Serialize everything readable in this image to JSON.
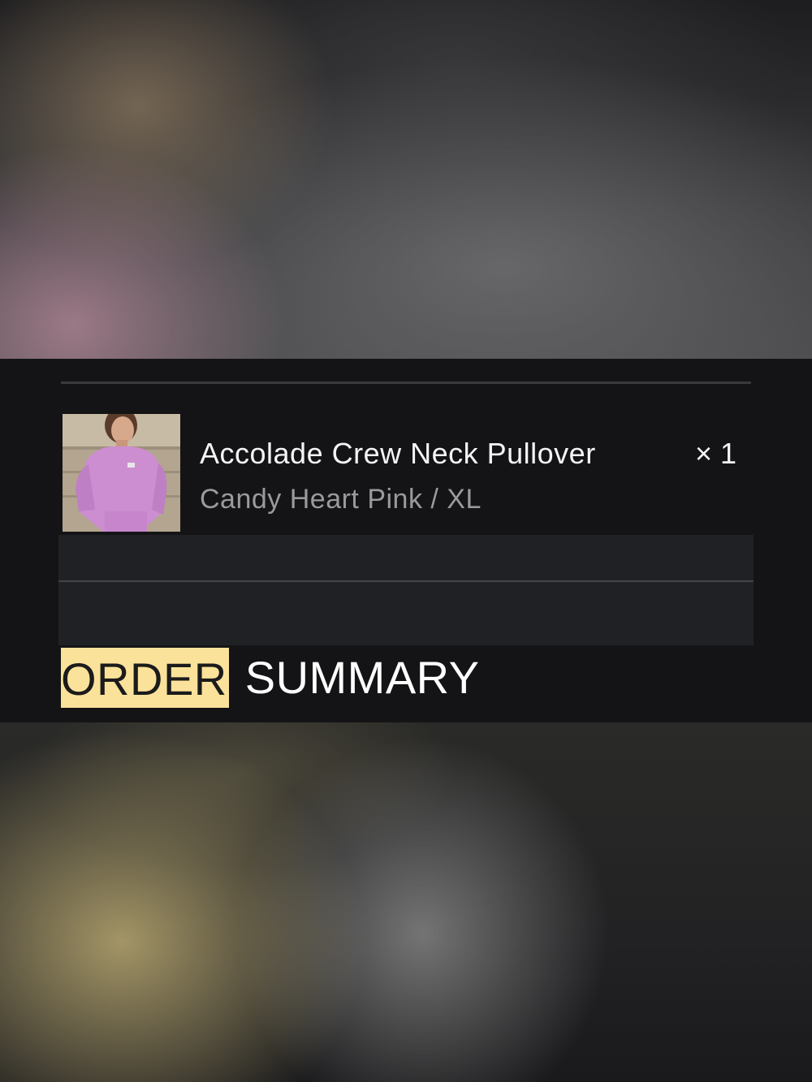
{
  "cart": {
    "line_items": [
      {
        "name": "Accolade Crew Neck Pullover",
        "quantity": "× 1",
        "variant": "Candy Heart Pink / XL",
        "image_icon": "product-thumbnail"
      }
    ]
  },
  "section": {
    "title_highlight": "ORDER",
    "title_rest": "SUMMARY"
  },
  "colors": {
    "sheet_background": "#141416",
    "row_background": "#202125",
    "highlight": "#fbe29a",
    "text_primary": "#f4f4f6",
    "text_secondary": "#9a9a9e"
  }
}
